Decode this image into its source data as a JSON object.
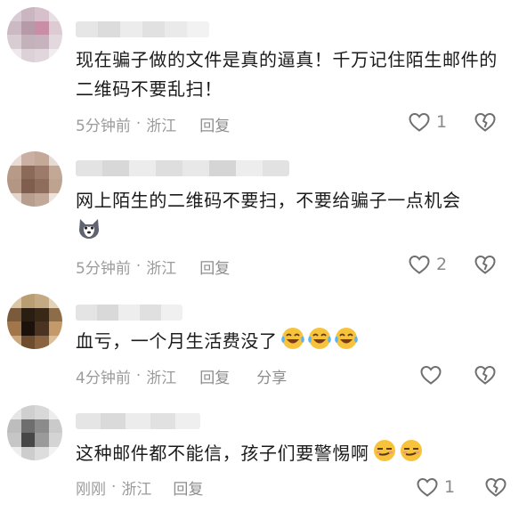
{
  "comments": [
    {
      "text": "现在骗子做的文件是真的逼真！千万记住陌生邮件的二维码不要乱扫！",
      "time": "5分钟前",
      "location": "浙江",
      "reply_label": "回复",
      "likes": "1"
    },
    {
      "text": "网上陌生的二维码不要扫，不要给骗子一点机会",
      "time": "5分钟前",
      "location": "浙江",
      "reply_label": "回复",
      "likes": "2"
    },
    {
      "text": "血亏，一个月生活费没了",
      "time": "4分钟前",
      "location": "浙江",
      "reply_label": "回复",
      "share_label": "分享"
    },
    {
      "text": "这种邮件都不能信，孩子们要警惕啊",
      "time": "刚刚",
      "location": "浙江",
      "reply_label": "回复",
      "likes": "1"
    }
  ],
  "icons": {
    "like": "heart-outline-icon",
    "dislike": "broken-heart-outline-icon",
    "emoji_dog": "husky-dog-emoji-icon",
    "emoji_laugh": "laughing-tears-emoji-icon",
    "emoji_smirk": "smirk-emoji-icon"
  },
  "colors": {
    "meta_text": "#9b9b9b",
    "icon_stroke": "#6f6f6f"
  }
}
